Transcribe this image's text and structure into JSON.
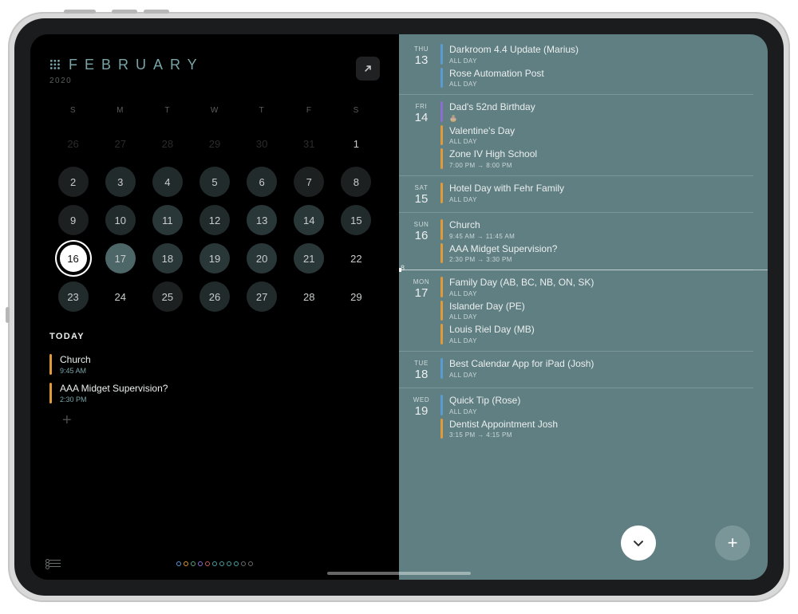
{
  "header": {
    "month": "FEBRUARY",
    "year": "2020"
  },
  "weekdays": [
    "S",
    "M",
    "T",
    "W",
    "T",
    "F",
    "S"
  ],
  "calendar": {
    "rows": [
      [
        {
          "n": "26",
          "cls": "prev"
        },
        {
          "n": "27",
          "cls": "prev"
        },
        {
          "n": "28",
          "cls": "prev"
        },
        {
          "n": "29",
          "cls": "prev"
        },
        {
          "n": "30",
          "cls": "prev"
        },
        {
          "n": "31",
          "cls": "prev"
        },
        {
          "n": "1",
          "cls": "none"
        }
      ],
      [
        {
          "n": "2",
          "cls": "dot1"
        },
        {
          "n": "3",
          "cls": "dot2"
        },
        {
          "n": "4",
          "cls": "dot2"
        },
        {
          "n": "5",
          "cls": "dot2"
        },
        {
          "n": "6",
          "cls": "dot2"
        },
        {
          "n": "7",
          "cls": "dot1"
        },
        {
          "n": "8",
          "cls": "dot1"
        }
      ],
      [
        {
          "n": "9",
          "cls": "dot1"
        },
        {
          "n": "10",
          "cls": "dot2"
        },
        {
          "n": "11",
          "cls": "dot3"
        },
        {
          "n": "12",
          "cls": "dot2"
        },
        {
          "n": "13",
          "cls": "dot3"
        },
        {
          "n": "14",
          "cls": "dot3"
        },
        {
          "n": "15",
          "cls": "dot2"
        }
      ],
      [
        {
          "n": "16",
          "cls": "sel-today"
        },
        {
          "n": "17",
          "cls": "highlight"
        },
        {
          "n": "18",
          "cls": "dot3"
        },
        {
          "n": "19",
          "cls": "dot3"
        },
        {
          "n": "20",
          "cls": "dot3"
        },
        {
          "n": "21",
          "cls": "dot3"
        },
        {
          "n": "22",
          "cls": "none"
        }
      ],
      [
        {
          "n": "23",
          "cls": "dot2"
        },
        {
          "n": "24",
          "cls": "none"
        },
        {
          "n": "25",
          "cls": "dot1"
        },
        {
          "n": "26",
          "cls": "dot2"
        },
        {
          "n": "27",
          "cls": "dot2"
        },
        {
          "n": "28",
          "cls": "none"
        },
        {
          "n": "29",
          "cls": "none"
        }
      ]
    ]
  },
  "today": {
    "label": "TODAY",
    "items": [
      {
        "color": "#e09a3a",
        "title": "Church",
        "time": "9:45 AM"
      },
      {
        "color": "#e09a3a",
        "title": "AAA Midget Supervision?",
        "time": "2:30 PM"
      }
    ]
  },
  "week_marker": "8",
  "agenda": [
    {
      "wd": "THU",
      "dn": "13",
      "events": [
        {
          "color": "#5a9bd4",
          "title": "Darkroom 4.4 Update (Marius)",
          "sub": "ALL DAY"
        },
        {
          "color": "#5a9bd4",
          "title": "Rose Automation Post",
          "sub": "ALL DAY"
        }
      ]
    },
    {
      "wd": "FRI",
      "dn": "14",
      "events": [
        {
          "color": "#8a6fd0",
          "title": "Dad's 52nd Birthday",
          "sub": "🎂"
        },
        {
          "color": "#e09a3a",
          "title": "Valentine's Day",
          "sub": "ALL DAY"
        },
        {
          "color": "#e09a3a",
          "title": "Zone IV High School",
          "sub": "7:00 PM → 8:00 PM"
        }
      ]
    },
    {
      "wd": "SAT",
      "dn": "15",
      "events": [
        {
          "color": "#e09a3a",
          "title": "Hotel Day with Fehr Family",
          "sub": "ALL DAY"
        }
      ]
    },
    {
      "wd": "SUN",
      "dn": "16",
      "events": [
        {
          "color": "#e09a3a",
          "title": "Church",
          "sub": "9:45 AM → 11:45 AM"
        },
        {
          "color": "#e09a3a",
          "title": "AAA Midget Supervision?",
          "sub": "2:30 PM → 3:30 PM"
        }
      ]
    },
    {
      "wd": "MON",
      "dn": "17",
      "events": [
        {
          "color": "#e09a3a",
          "title": "Family Day (AB, BC, NB, ON, SK)",
          "sub": "ALL DAY"
        },
        {
          "color": "#e09a3a",
          "title": "Islander Day (PE)",
          "sub": "ALL DAY"
        },
        {
          "color": "#e09a3a",
          "title": "Louis Riel Day (MB)",
          "sub": "ALL DAY"
        }
      ]
    },
    {
      "wd": "TUE",
      "dn": "18",
      "events": [
        {
          "color": "#5a9bd4",
          "title": "Best Calendar App for iPad (Josh)",
          "sub": "ALL DAY"
        }
      ]
    },
    {
      "wd": "WED",
      "dn": "19",
      "events": [
        {
          "color": "#5a9bd4",
          "title": "Quick Tip (Rose)",
          "sub": "ALL DAY"
        },
        {
          "color": "#e09a3a",
          "title": "Dentist Appointment Josh",
          "sub": "3:15 PM → 4:15 PM"
        }
      ]
    }
  ]
}
